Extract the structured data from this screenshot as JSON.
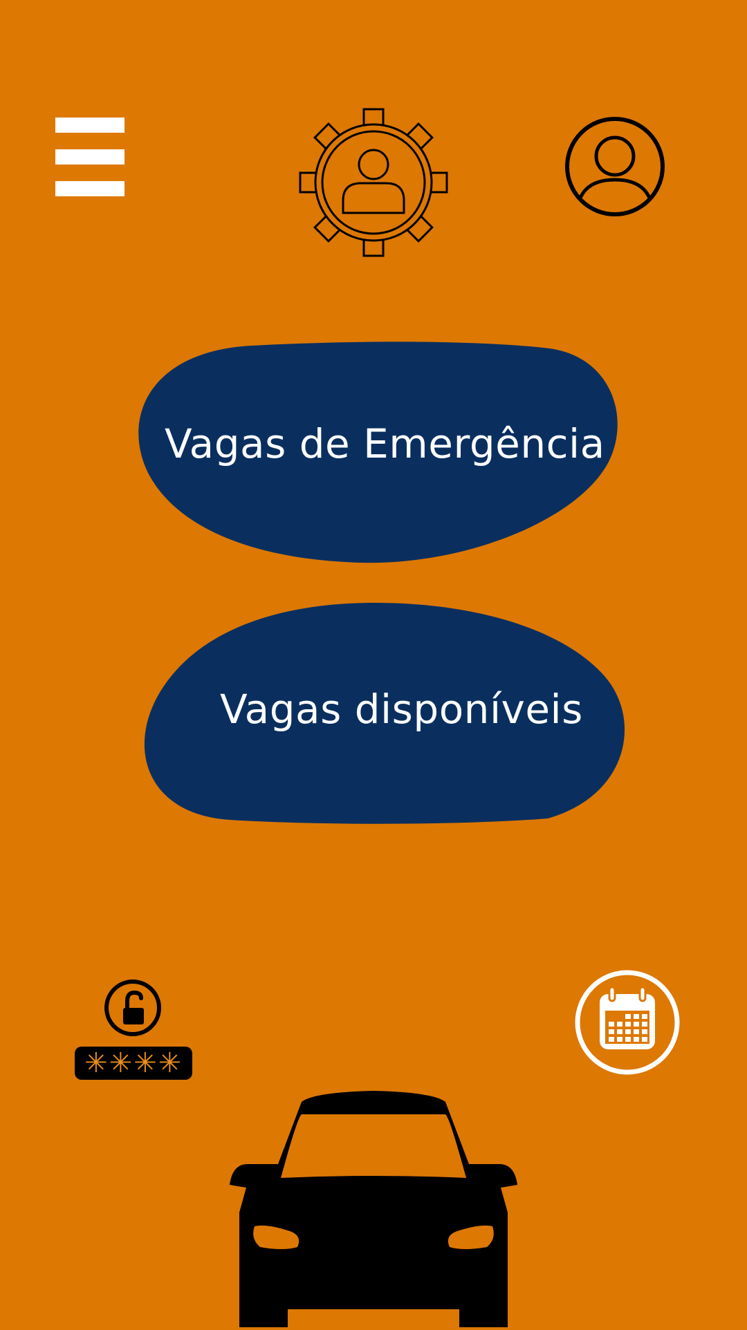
{
  "colors": {
    "background": "#dd7803",
    "button_fill": "#0a2f5f",
    "button_text": "#ffffff",
    "icon_dark": "#000000",
    "icon_light": "#ffffff",
    "password_mask": "#ea8e1e"
  },
  "header": {
    "menu_icon": "hamburger-menu-icon",
    "settings_icon": "gear-user-icon",
    "profile_icon": "user-circle-icon"
  },
  "main": {
    "emergency_button_label": "Vagas de Emergência",
    "available_button_label": "Vagas disponíveis"
  },
  "footer": {
    "lock_icon": "unlocked-padlock-icon",
    "password_mask": "✳✳✳✳",
    "calendar_icon": "calendar-icon",
    "car_icon": "car-icon"
  }
}
